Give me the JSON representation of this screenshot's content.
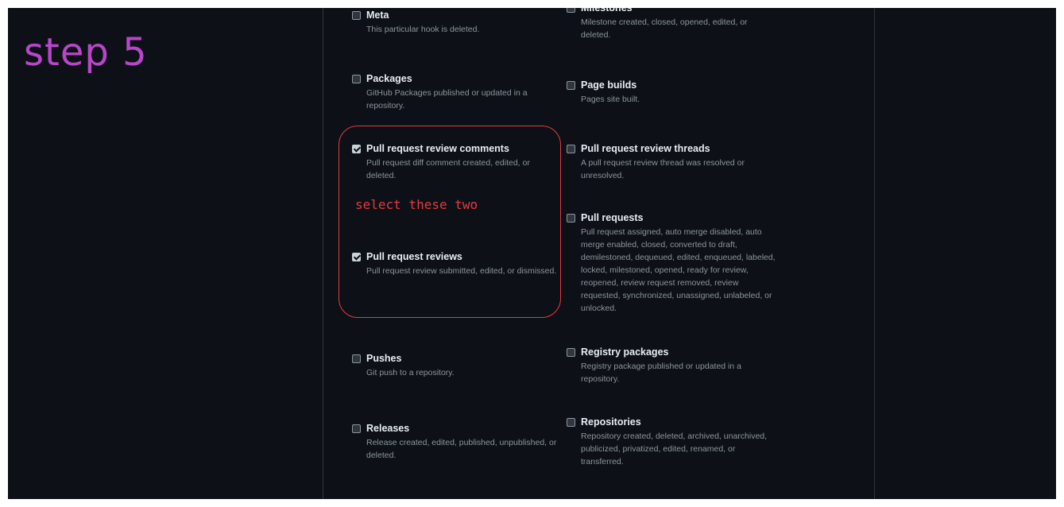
{
  "annotations": {
    "step": "step 5",
    "note": "select these two"
  },
  "events": [
    {
      "title": "Meta",
      "desc": "This particular hook is deleted.",
      "checked": false
    },
    {
      "title": "Milestones",
      "desc": "Milestone created, closed, opened, edited, or deleted.",
      "checked": false
    },
    {
      "title": "Packages",
      "desc": "GitHub Packages published or updated in a repository.",
      "checked": false
    },
    {
      "title": "Page builds",
      "desc": "Pages site built.",
      "checked": false
    },
    {
      "title": "Pull request review comments",
      "desc": "Pull request diff comment created, edited, or deleted.",
      "checked": true
    },
    {
      "title": "Pull request review threads",
      "desc": "A pull request review thread was resolved or unresolved.",
      "checked": false
    },
    {
      "title": "Pull requests",
      "desc": "Pull request assigned, auto merge disabled, auto merge enabled, closed, converted to draft, demilestoned, dequeued, edited, enqueued, labeled, locked, milestoned, opened, ready for review, reopened, review request removed, review requested, synchronized, unassigned, unlabeled, or unlocked.",
      "checked": false
    },
    {
      "title": "Pull request reviews",
      "desc": "Pull request review submitted, edited, or dismissed.",
      "checked": true
    },
    {
      "title": "Pushes",
      "desc": "Git push to a repository.",
      "checked": false
    },
    {
      "title": "Registry packages",
      "desc": "Registry package published or updated in a repository.",
      "checked": false
    },
    {
      "title": "Releases",
      "desc": "Release created, edited, published, unpublished, or deleted.",
      "checked": false
    },
    {
      "title": "Repositories",
      "desc": "Repository created, deleted, archived, unarchived, publicized, privatized, edited, renamed, or transferred.",
      "checked": false
    }
  ]
}
